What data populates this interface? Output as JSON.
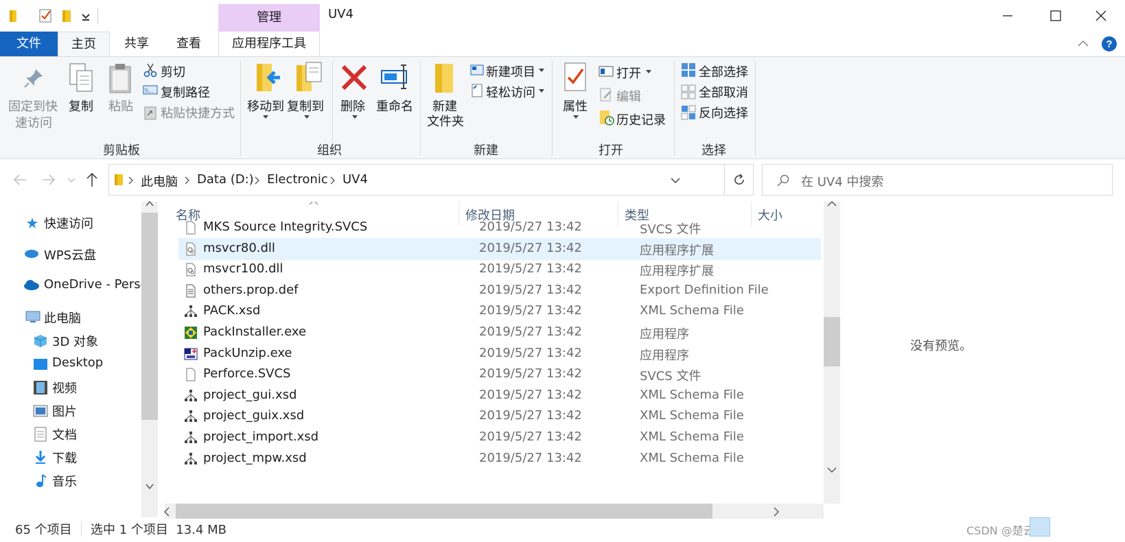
{
  "window": {
    "title": "UV4",
    "contextual_tab": "管理",
    "minimize_icon": "minimize-icon",
    "maximize_icon": "maximize-icon",
    "close_icon": "close-icon"
  },
  "tabs": [
    "文件",
    "主页",
    "共享",
    "查看",
    "应用程序工具"
  ],
  "ribbon": {
    "clipboard": {
      "label": "剪贴板",
      "pin_line1": "固定到快",
      "pin_line2": "速访问",
      "copy": "复制",
      "paste": "粘贴",
      "cut": "剪切",
      "copy_path": "复制路径",
      "paste_shortcut": "粘贴快捷方式"
    },
    "organize": {
      "label": "组织",
      "move_to": "移动到",
      "copy_to": "复制到",
      "delete": "删除",
      "rename": "重命名"
    },
    "new": {
      "label": "新建",
      "new_folder_line1": "新建",
      "new_folder_line2": "文件夹",
      "new_item": "新建项目",
      "easy_access": "轻松访问"
    },
    "open": {
      "label": "打开",
      "properties": "属性",
      "open": "打开",
      "edit": "编辑",
      "history": "历史记录"
    },
    "select": {
      "label": "选择",
      "select_all": "全部选择",
      "select_none": "全部取消",
      "invert": "反向选择"
    }
  },
  "address": {
    "crumbs": [
      "此电脑",
      "Data (D:)",
      "Electronic",
      "UV4"
    ],
    "search_placeholder": "在 UV4 中搜索"
  },
  "nav": {
    "items": [
      "快速访问",
      "WPS云盘",
      "OneDrive - Perso",
      "此电脑",
      "3D 对象",
      "Desktop",
      "视频",
      "图片",
      "文档",
      "下载",
      "音乐"
    ]
  },
  "list": {
    "columns": [
      "名称",
      "修改日期",
      "类型",
      "大小"
    ],
    "rows": [
      {
        "name": "MKS Source Integrity.SVCS",
        "date": "2019/5/27 13:42",
        "type": "SVCS 文件",
        "icon": "blank-file-icon"
      },
      {
        "name": "msvcr80.dll",
        "date": "2019/5/27 13:42",
        "type": "应用程序扩展",
        "icon": "dll-file-icon"
      },
      {
        "name": "msvcr100.dll",
        "date": "2019/5/27 13:42",
        "type": "应用程序扩展",
        "icon": "dll-file-icon"
      },
      {
        "name": "others.prop.def",
        "date": "2019/5/27 13:42",
        "type": "Export Definition File",
        "icon": "text-file-icon"
      },
      {
        "name": "PACK.xsd",
        "date": "2019/5/27 13:42",
        "type": "XML Schema File",
        "icon": "xsd-file-icon"
      },
      {
        "name": "PackInstaller.exe",
        "date": "2019/5/27 13:42",
        "type": "应用程序",
        "icon": "installer-exe-icon"
      },
      {
        "name": "PackUnzip.exe",
        "date": "2019/5/27 13:42",
        "type": "应用程序",
        "icon": "unzip-exe-icon"
      },
      {
        "name": "Perforce.SVCS",
        "date": "2019/5/27 13:42",
        "type": "SVCS 文件",
        "icon": "blank-file-icon"
      },
      {
        "name": "project_gui.xsd",
        "date": "2019/5/27 13:42",
        "type": "XML Schema File",
        "icon": "xsd-file-icon"
      },
      {
        "name": "project_guix.xsd",
        "date": "2019/5/27 13:42",
        "type": "XML Schema File",
        "icon": "xsd-file-icon"
      },
      {
        "name": "project_import.xsd",
        "date": "2019/5/27 13:42",
        "type": "XML Schema File",
        "icon": "xsd-file-icon"
      },
      {
        "name": "project_mpw.xsd",
        "date": "2019/5/27 13:42",
        "type": "XML Schema File",
        "icon": "xsd-file-icon"
      }
    ],
    "selected_index": 1
  },
  "preview": {
    "text": "没有预览。"
  },
  "status": {
    "count": "65 个项目",
    "selection": "选中 1 个项目  13.4 MB",
    "watermark": "CSDN @楚云随"
  }
}
